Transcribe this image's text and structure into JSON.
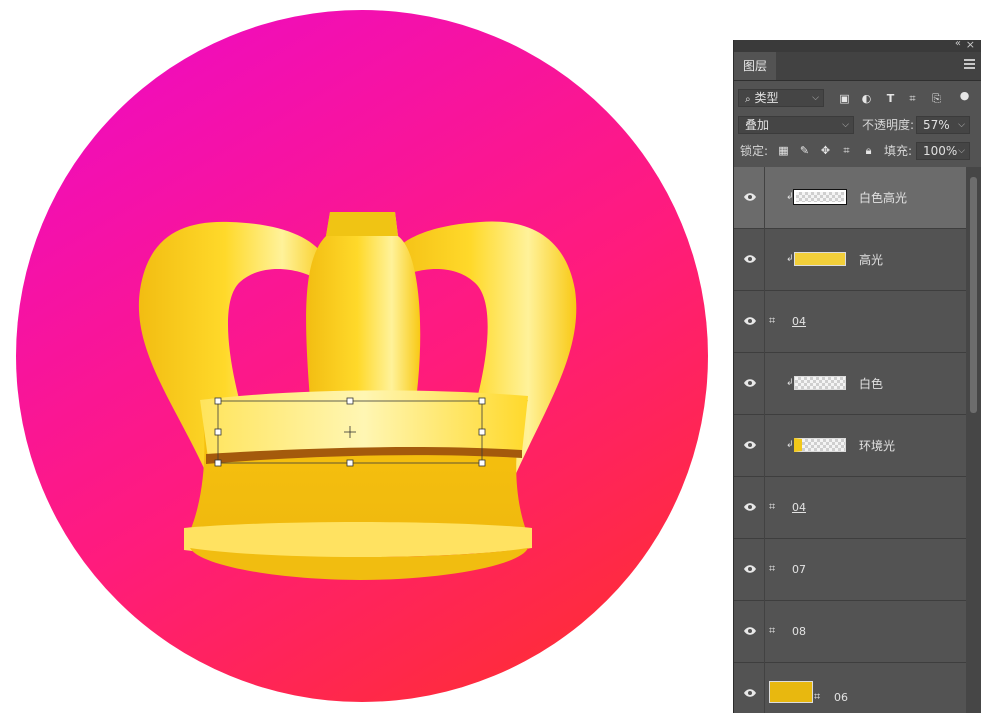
{
  "panel": {
    "tab_label": "图层",
    "filter_kind": "类型",
    "blend_mode": "叠加",
    "opacity_label": "不透明度:",
    "opacity_value": "57%",
    "lock_label": "锁定:",
    "fill_label": "填充:",
    "fill_value": "100%"
  },
  "layers": [
    {
      "name": "白色高光",
      "type": "clipped",
      "selected": true
    },
    {
      "name": "高光",
      "type": "clipped",
      "selected": false
    },
    {
      "name": "04",
      "type": "shape",
      "selected": false
    },
    {
      "name": "白色",
      "type": "clipped",
      "selected": false
    },
    {
      "name": "环境光",
      "type": "clipped",
      "selected": false
    },
    {
      "name": "04",
      "type": "shape",
      "selected": false
    },
    {
      "name": "07",
      "type": "shape",
      "selected": false
    },
    {
      "name": "08",
      "type": "shape",
      "selected": false
    },
    {
      "name": "06",
      "type": "shape",
      "selected": false
    }
  ],
  "colors": {
    "panel_bg": "#535353",
    "selected_row": "#6b6b6b",
    "circle_top": "#f00fba",
    "circle_bottom": "#ff2d3a",
    "crown_gold": "#f7c512",
    "crown_light": "#fff3a0"
  }
}
